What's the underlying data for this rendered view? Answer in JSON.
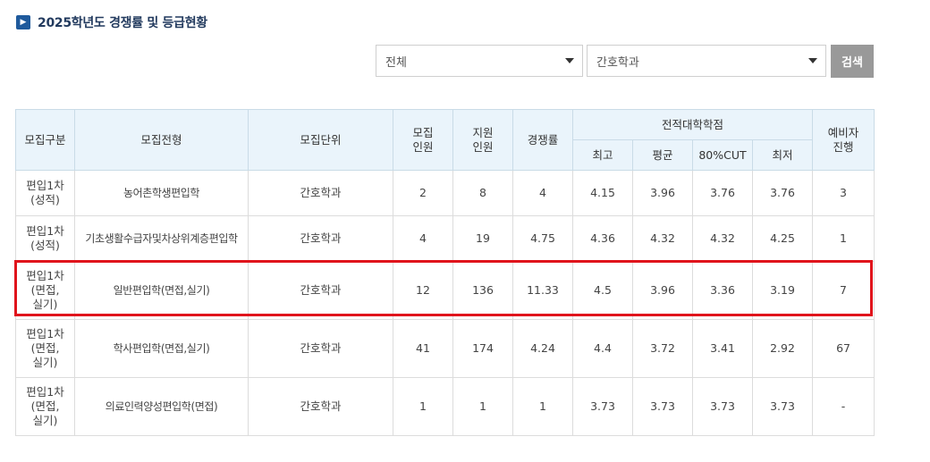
{
  "heading": {
    "icon": "chevron-right-icon",
    "title": "2025학년도 경쟁률 및 등급현황"
  },
  "filters": {
    "category": {
      "selected": "전체"
    },
    "department": {
      "selected": "간호학과"
    },
    "search_label": "검색"
  },
  "table": {
    "headers": {
      "type": "모집구분",
      "track": "모집전형",
      "unit": "모집단위",
      "quota": "모집\n인원",
      "applicants": "지원\n인원",
      "ratio": "경쟁률",
      "gpa_group": "전적대학학점",
      "gpa_max": "최고",
      "gpa_avg": "평균",
      "gpa_cut": "80%CUT",
      "gpa_min": "최저",
      "waitlist": "예비자\n진행"
    },
    "rows": [
      {
        "type": "편입1차\n(성적)",
        "track": "농어촌학생편입학",
        "unit": "간호학과",
        "quota": "2",
        "applicants": "8",
        "ratio": "4",
        "max": "4.15",
        "avg": "3.96",
        "cut": "3.76",
        "min": "3.76",
        "waitlist": "3"
      },
      {
        "type": "편입1차\n(성적)",
        "track": "기초생활수급자및차상위계층편입학",
        "unit": "간호학과",
        "quota": "4",
        "applicants": "19",
        "ratio": "4.75",
        "max": "4.36",
        "avg": "4.32",
        "cut": "4.32",
        "min": "4.25",
        "waitlist": "1"
      },
      {
        "type": "편입1차\n(면접,\n실기)",
        "track": "일반편입학(면접,실기)",
        "unit": "간호학과",
        "quota": "12",
        "applicants": "136",
        "ratio": "11.33",
        "max": "4.5",
        "avg": "3.96",
        "cut": "3.36",
        "min": "3.19",
        "waitlist": "7"
      },
      {
        "type": "편입1차\n(면접,\n실기)",
        "track": "학사편입학(면접,실기)",
        "unit": "간호학과",
        "quota": "41",
        "applicants": "174",
        "ratio": "4.24",
        "max": "4.4",
        "avg": "3.72",
        "cut": "3.41",
        "min": "2.92",
        "waitlist": "67"
      },
      {
        "type": "편입1차\n(면접,\n실기)",
        "track": "의료인력양성편입학(면접)",
        "unit": "간호학과",
        "quota": "1",
        "applicants": "1",
        "ratio": "1",
        "max": "3.73",
        "avg": "3.73",
        "cut": "3.73",
        "min": "3.73",
        "waitlist": "-"
      }
    ]
  },
  "colors": {
    "highlight": "#e0141c",
    "header_bg": "#eaf4fb",
    "heading_icon": "#1f5a9c",
    "search_bg": "#999999"
  }
}
